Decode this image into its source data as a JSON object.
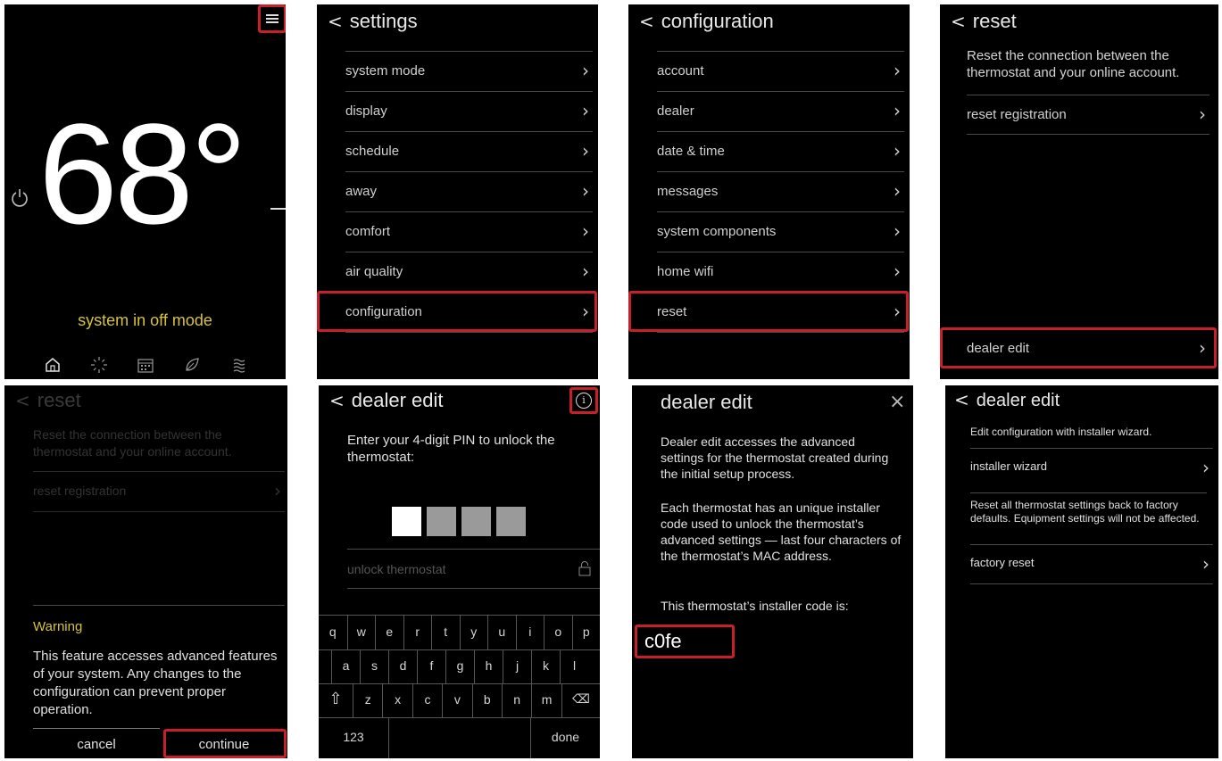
{
  "colors": {
    "accent_highlight": "#c8202a",
    "yellow_text": "#d6c33a",
    "panel_bg": "#000000"
  },
  "p1": {
    "temperature": "68°",
    "status": "system in off mode",
    "nav_icons": [
      "home-icon",
      "sun-icon",
      "calendar-icon",
      "leaf-icon",
      "wind-icon"
    ]
  },
  "p2": {
    "title": "settings",
    "items": [
      "system mode",
      "display",
      "schedule",
      "away",
      "comfort",
      "air quality",
      "configuration"
    ]
  },
  "p3": {
    "title": "configuration",
    "items": [
      "account",
      "dealer",
      "date & time",
      "messages",
      "system components",
      "home wifi",
      "reset"
    ]
  },
  "p4": {
    "title": "reset",
    "description": "Reset the connection between the thermostat and your online account.",
    "item": "reset registration",
    "dealer_edit": "dealer edit"
  },
  "p5": {
    "title": "reset",
    "description": "Reset the connection between the thermostat and your online account.",
    "item": "reset registration",
    "warning_title": "Warning",
    "warning_text": "This feature accesses advanced features of your system. Any changes to the configuration can prevent proper operation.",
    "cancel": "cancel",
    "continue": "continue"
  },
  "p6": {
    "title": "dealer edit",
    "prompt": "Enter your 4-digit PIN to unlock the thermostat:",
    "unlock_placeholder": "unlock thermostat",
    "keys_row1": [
      "q",
      "w",
      "e",
      "r",
      "t",
      "y",
      "u",
      "i",
      "o",
      "p"
    ],
    "keys_row2": [
      "a",
      "s",
      "d",
      "f",
      "g",
      "h",
      "j",
      "k",
      "l"
    ],
    "keys_row3": [
      "z",
      "x",
      "c",
      "v",
      "b",
      "n",
      "m"
    ],
    "key_123": "123",
    "key_done": "done"
  },
  "p7": {
    "title": "dealer edit",
    "para1": "Dealer edit accesses the advanced settings for the thermostat created during the initial setup process.",
    "para2": "Each thermostat has an unique installer code used to unlock the thermostat’s advanced settings — last four characters of the thermostat’s MAC address.",
    "para3": "This thermostat’s installer code is:",
    "code": "c0fe"
  },
  "p8": {
    "title": "dealer edit",
    "desc1": "Edit configuration with installer wizard.",
    "item1": "installer wizard",
    "desc2": "Reset all thermostat settings back to factory defaults. Equipment settings will not be affected.",
    "item2": "factory reset"
  }
}
